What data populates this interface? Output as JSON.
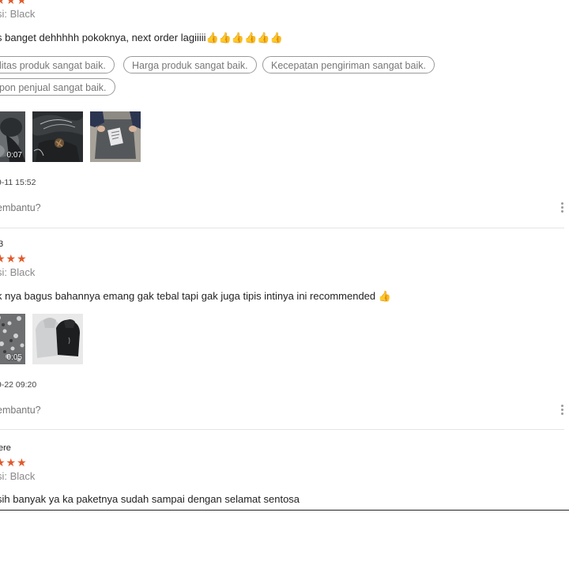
{
  "reviews": [
    {
      "username": "",
      "stars": "★★★",
      "variation": "si: Black",
      "comment": "s banget dehhhhh pokoknya, next order lagiiiii👍👍👍👍👍👍",
      "tags": [
        "litas produk sangat baik.",
        "Harga produk sangat baik.",
        "Kecepatan pengiriman sangat baik.",
        "pon penjual sangat baik."
      ],
      "media": [
        {
          "type": "video",
          "duration": "0:07"
        },
        {
          "type": "image"
        },
        {
          "type": "image"
        }
      ],
      "timestamp": "9-11 15:52",
      "helpful": "embantu?"
    },
    {
      "username": "3",
      "stars": "★★★",
      "variation": "si: Black",
      "comment": "k nya bagus bahannya emang gak tebal tapi gak juga tipis intinya ini recommended 👍",
      "tags": [],
      "media": [
        {
          "type": "video",
          "duration": "0:05"
        },
        {
          "type": "image"
        }
      ],
      "timestamp": "9-22 09:20",
      "helpful": "embantu?"
    },
    {
      "username": "ere",
      "stars": "★★★",
      "variation": "si: Black",
      "comment": "sih banyak ya ka paketnya sudah sampai dengan selamat sentosa",
      "tags": [],
      "media": [],
      "timestamp": "",
      "helpful": ""
    }
  ],
  "colors": {
    "star": "#e05a2b",
    "muted_text": "#8a8a8a",
    "divider": "#e4e4e4"
  },
  "icons": {
    "more": "more-vertical-icon",
    "thumbs_up": "thumbs-up-emoji"
  }
}
